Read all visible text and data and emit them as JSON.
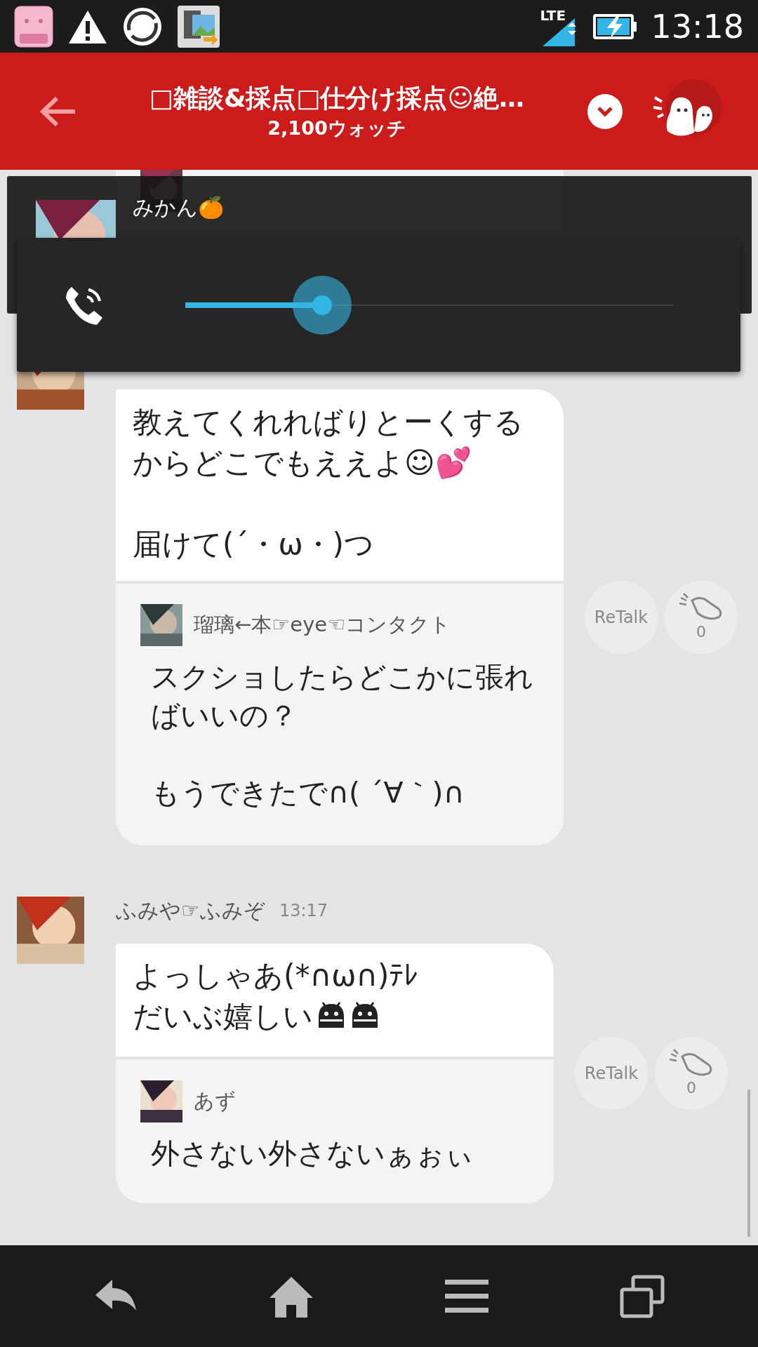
{
  "status_bar": {
    "network": "LTE",
    "time": "13:18"
  },
  "header": {
    "title": "□雑談&採点□仕分け採点☺絶…",
    "subtitle": "2,100ウォッチ"
  },
  "notification": {
    "sender": "みかん🍊"
  },
  "volume_panel": {
    "level": 0.28
  },
  "messages": [
    {
      "body": [
        "教えてくれればりとーくするからどこでもええよ☺💕",
        "届けて(´・ω・)つ"
      ],
      "droid_emoji": false,
      "quote": {
        "author": "瑠璃←本☞eye☜コンタクト",
        "text": [
          "スクショしたらどこかに張ればいいの？",
          "もうできたで∩( ´∀｀)∩"
        ]
      },
      "retalk": "ReTalk",
      "claps": "0"
    },
    {
      "author": "ふみや☞ふみぞ",
      "time": "13:17",
      "body": [
        "よっしゃあ(*∩ω∩)ﾃﾚ",
        "だいぶ嬉しい"
      ],
      "droid_emoji": true,
      "quote": {
        "author": "あず",
        "text": [
          "外さない外さないぁぉぃ"
        ]
      },
      "retalk": "ReTalk",
      "claps": "0"
    }
  ]
}
